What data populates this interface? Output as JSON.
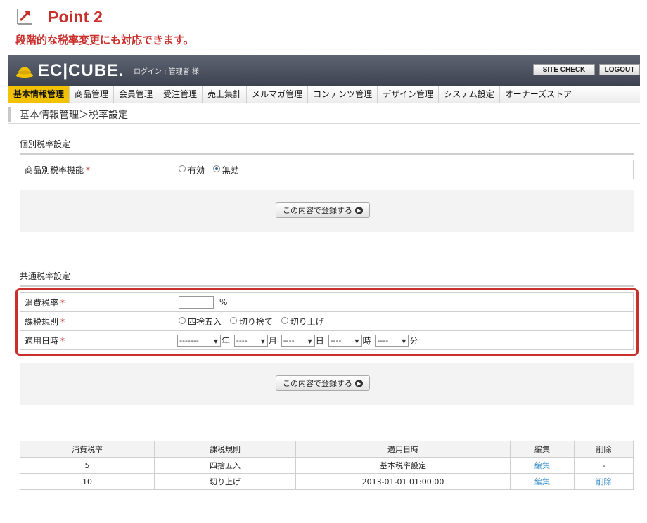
{
  "point": {
    "title": "Point 2",
    "subtitle": "段階的な税率変更にも対応できます。"
  },
  "header": {
    "logo_text": "EC|CUBE.",
    "login_text": "ログイン : 管理者 様",
    "site_check_label": "SITE CHECK",
    "logout_label": "LOGOUT"
  },
  "nav": {
    "items": [
      "基本情報管理",
      "商品管理",
      "会員管理",
      "受注管理",
      "売上集計",
      "メルマガ管理",
      "コンテンツ管理",
      "デザイン管理",
      "システム設定",
      "オーナーズストア"
    ]
  },
  "breadcrumb": "基本情報管理＞税率設定",
  "individual": {
    "section_title": "個別税率設定",
    "row_label": "商品別税率機能",
    "required_mark": "*",
    "option_enabled": "有効",
    "option_disabled": "無効",
    "register_label": "この内容で登録する"
  },
  "common": {
    "section_title": "共通税率設定",
    "tax_rate_label": "消費税率",
    "tax_rate_value": "",
    "tax_rate_unit": "%",
    "rounding_label": "課税規則",
    "rounding_options": [
      "四捨五入",
      "切り捨て",
      "切り上げ"
    ],
    "apply_date_label": "適用日時",
    "year_select": "-------",
    "month_select": "----",
    "day_select": "----",
    "hour_select": "----",
    "minute_select": "----",
    "unit_year": "年",
    "unit_month": "月",
    "unit_day": "日",
    "unit_hour": "時",
    "unit_minute": "分",
    "required_mark": "*",
    "register_label": "この内容で登録する"
  },
  "list": {
    "headers": [
      "消費税率",
      "課税規則",
      "適用日時",
      "編集",
      "削除"
    ],
    "rows": [
      {
        "rate": "5",
        "rule": "四捨五入",
        "date": "基本税率設定",
        "edit": "編集",
        "delete": "-"
      },
      {
        "rate": "10",
        "rule": "切り上げ",
        "date": "2013-01-01 01:00:00",
        "edit": "編集",
        "delete": "削除"
      }
    ]
  },
  "colors": {
    "accent_red": "#c9302c",
    "nav_active": "#f2c200",
    "header_bg": "#474c59",
    "link_blue": "#3a8fc4"
  }
}
